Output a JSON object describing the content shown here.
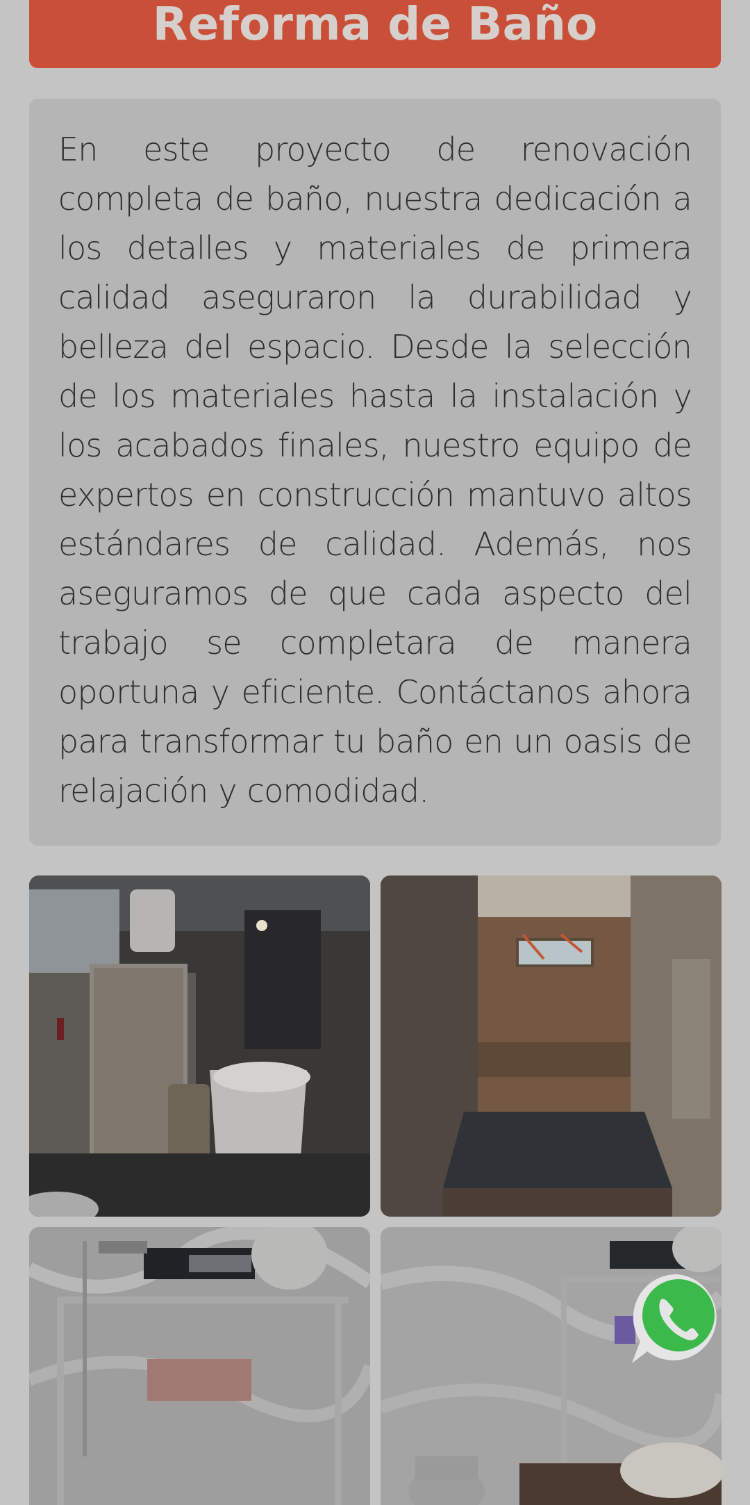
{
  "header": {
    "title": "Reforma de Baño"
  },
  "description": {
    "text": "En este proyecto de renovación completa de baño, nuestra dedicación a los detalles y materiales de primera calidad aseguraron la durabilidad y belleza del espacio. Desde la selección de los materiales hasta la instalación y los acabados finales, nuestro equipo de expertos en construcción mantuvo altos estándares de calidad. Además, nos aseguramos de que cada aspecto del trabajo se completara de manera oportuna y eficiente. Contáctanos ahora para transformar tu baño en un oasis de relajación y comodidad."
  },
  "gallery": {
    "photos": [
      {
        "subject": "bathroom-before"
      },
      {
        "subject": "bathroom-demolition"
      },
      {
        "subject": "bathroom-shower-after"
      },
      {
        "subject": "bathroom-finished"
      }
    ]
  },
  "floating": {
    "whatsapp_icon": "whatsapp-icon",
    "whatsapp_color": "#3bb94a"
  },
  "colors": {
    "banner": "#c94f38",
    "page_background": "#c4c4c4",
    "card_background": "#b5b5b5"
  }
}
